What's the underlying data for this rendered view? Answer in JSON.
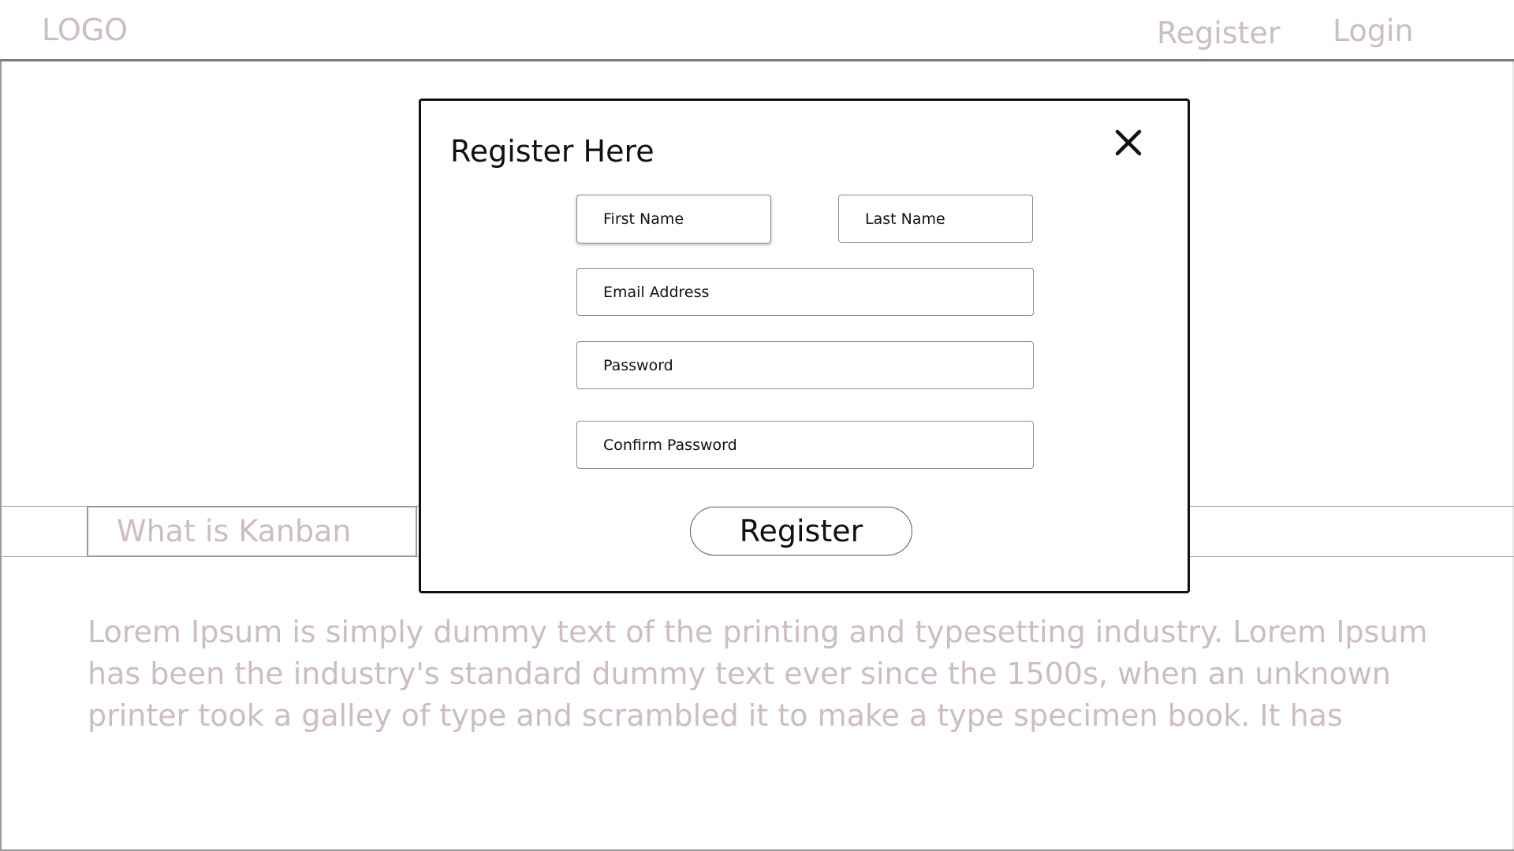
{
  "header": {
    "logo_text": "LOGO",
    "nav": {
      "register_label": "Register",
      "login_label": "Login"
    }
  },
  "section": {
    "tab_label": "What is Kanban",
    "body_text": "Lorem Ipsum is simply dummy text of the printing and typesetting industry. Lorem Ipsum has been the industry's standard dummy text ever since the 1500s, when an unknown printer took a galley of type and scrambled it to make a type specimen book. It has"
  },
  "modal": {
    "title": "Register Here",
    "close_icon": "close-icon",
    "fields": {
      "first_name_placeholder": "First Name",
      "last_name_placeholder": "Last Name",
      "email_placeholder": "Email Address",
      "password_placeholder": "Password",
      "confirm_password_placeholder": "Confirm Password"
    },
    "submit_label": "Register"
  },
  "colors": {
    "muted_text": "#cdbdbd",
    "primary_text": "#111111",
    "border": "#9a9a9a"
  }
}
